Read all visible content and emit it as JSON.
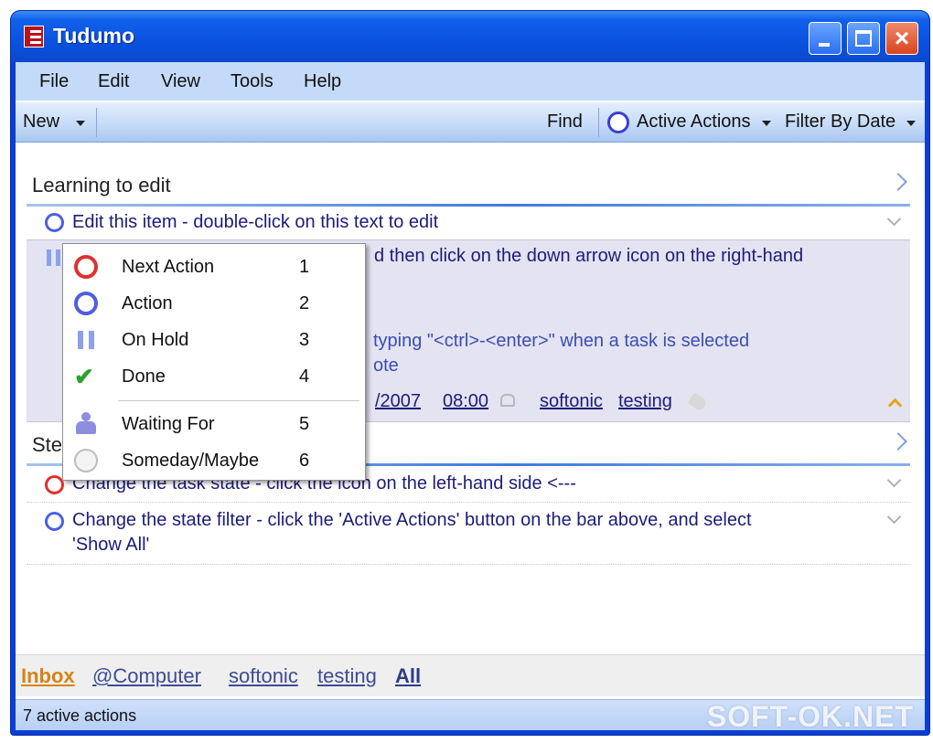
{
  "window": {
    "title": "Tudumo"
  },
  "menu": [
    "File",
    "Edit",
    "View",
    "Tools",
    "Help"
  ],
  "toolbar": {
    "new_label": "New",
    "find_label": "Find",
    "state_filter_label": "Active Actions",
    "date_filter_label": "Filter By Date"
  },
  "groups": [
    {
      "title": "Learning to edit",
      "items": [
        {
          "text": "Edit this item - double-click on this text to edit",
          "state": "action"
        }
      ],
      "expanded_item": {
        "line1": "d then click on the down arrow icon on the right-hand",
        "line2": "typing \"<ctrl>-<enter>\" when a task is selected",
        "line3": "ote",
        "date": "/2007",
        "time": "08:00",
        "tags": [
          "softonic",
          "testing"
        ]
      }
    },
    {
      "title": "Ste",
      "items": [
        {
          "text": "Change the task state - click the icon on the left-hand side <---",
          "state": "next-action"
        },
        {
          "text": "Change the state filter - click the 'Active Actions' button on the bar above, and select",
          "text2": "'Show All'",
          "state": "action"
        }
      ]
    }
  ],
  "state_menu": [
    {
      "label": "Next Action",
      "key": "1",
      "icon": "next-action-icon"
    },
    {
      "label": "Action",
      "key": "2",
      "icon": "action-icon"
    },
    {
      "label": "On Hold",
      "key": "3",
      "icon": "on-hold-icon"
    },
    {
      "label": "Done",
      "key": "4",
      "icon": "done-check-icon"
    },
    {
      "label": "Waiting For",
      "key": "5",
      "icon": "waiting-person-icon"
    },
    {
      "label": "Someday/Maybe",
      "key": "6",
      "icon": "someday-cloud-icon"
    }
  ],
  "filters": {
    "inbox": "Inbox",
    "computer": "@Computer",
    "softonic": "softonic",
    "testing": "testing",
    "all": "All"
  },
  "status": {
    "text": "7 active actions",
    "watermark": "SOFT-OK.NET"
  },
  "colors": {
    "title_bar": "#0a52e0",
    "next_action": "#e03030",
    "action": "#4e5ee0",
    "done": "#2da02d",
    "inbox_link": "#d68316"
  }
}
